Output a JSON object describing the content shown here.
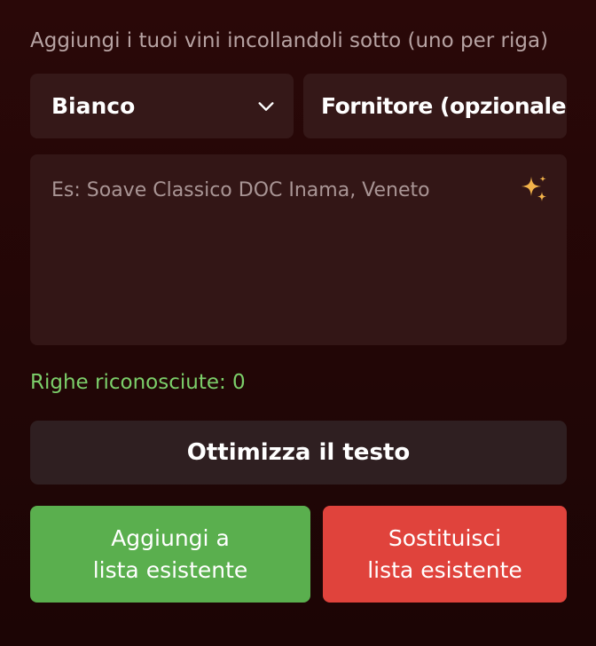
{
  "instructions": "Aggiungi i tuoi vini incollandoli sotto (uno per riga)",
  "category_select": {
    "value": "Bianco",
    "icon": "chevron-down-icon"
  },
  "supplier_input": {
    "placeholder": "Fornitore (opzionale)"
  },
  "wine_textarea": {
    "placeholder": "Es: Soave Classico DOC Inama, Veneto",
    "ai_icon": "sparkles-icon"
  },
  "recognized_rows": {
    "label": "Righe riconosciute: 0"
  },
  "optimize_button": {
    "label": "Ottimizza il testo"
  },
  "add_button": {
    "line1": "Aggiungi a",
    "line2": "lista esistente"
  },
  "replace_button": {
    "line1": "Sostituisci",
    "line2": "lista esistente"
  },
  "colors": {
    "background": "#220606",
    "field_bg": "#351818",
    "success_text": "#7ccf6a",
    "add_button_bg": "#5aaf4e",
    "replace_button_bg": "#e0433c",
    "sparkle": "#f3b34a"
  }
}
